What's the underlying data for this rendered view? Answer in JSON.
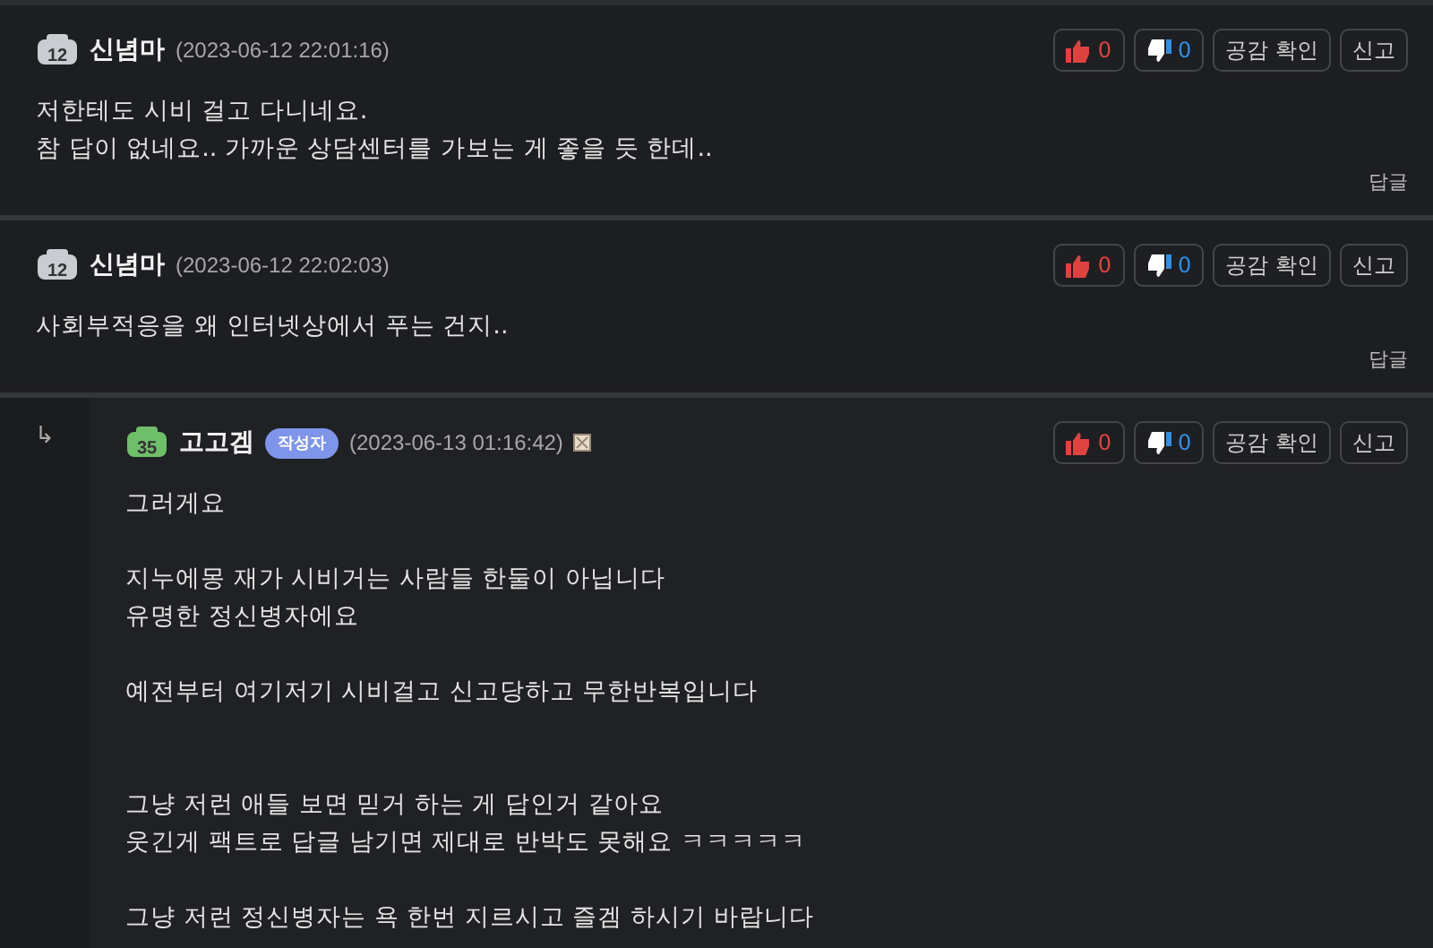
{
  "comments": [
    {
      "reply": false,
      "level_badge": "12",
      "color": "#c9ccd1",
      "author": "신념마",
      "timestamp": "(2023-06-12 22:01:16)",
      "flag": false,
      "likes": "0",
      "dislikes": "0",
      "empathy_label": "공감 확인",
      "report_label": "신고",
      "lines": [
        {
          "kind": "text",
          "text": "저한테도 시비 걸고 다니네요."
        },
        {
          "kind": "text",
          "text": "참 답이 없네요.. 가까운 상담센터를 가보는 게 좋을 듯 한데.."
        }
      ],
      "reply_label": "답글"
    },
    {
      "reply": false,
      "level_badge": "12",
      "color": "#c9ccd1",
      "author": "신념마",
      "timestamp": "(2023-06-12 22:02:03)",
      "flag": false,
      "likes": "0",
      "dislikes": "0",
      "empathy_label": "공감 확인",
      "report_label": "신고",
      "lines": [
        {
          "kind": "text",
          "text": "사회부적응을 왜 인터넷상에서 푸는 건지.."
        }
      ],
      "reply_label": "답글"
    },
    {
      "reply": true,
      "reply_arrow": "↳",
      "level_badge": "35",
      "color": "#6fbf6a",
      "author": "고고겜",
      "author_tag": "작성자",
      "timestamp": "(2023-06-13 01:16:42)",
      "flag": true,
      "likes": "0",
      "dislikes": "0",
      "empathy_label": "공감 확인",
      "report_label": "신고",
      "lines": [
        {
          "kind": "text",
          "text": "그러게요"
        },
        {
          "kind": "blank"
        },
        {
          "kind": "text",
          "text": "지누에몽 재가 시비거는 사람들 한둘이 아닙니다"
        },
        {
          "kind": "text",
          "text": "유명한 정신병자에요"
        },
        {
          "kind": "blank"
        },
        {
          "kind": "text",
          "text": "예전부터 여기저기 시비걸고 신고당하고 무한반복입니다"
        },
        {
          "kind": "blank"
        },
        {
          "kind": "blank"
        },
        {
          "kind": "text",
          "text": "그냥 저런 애들 보면 믿거 하는 게 답인거 같아요"
        },
        {
          "kind": "text",
          "text": "웃긴게 팩트로 답글 남기면 제대로 반박도 못해요 ㅋㅋㅋㅋㅋ"
        },
        {
          "kind": "blank"
        },
        {
          "kind": "text",
          "text": "그냥 저런 정신병자는 욕 한번 지르시고 즐겜 하시기 바랍니다"
        }
      ]
    }
  ]
}
